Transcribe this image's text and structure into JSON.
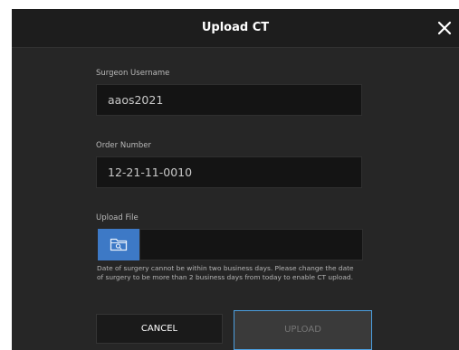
{
  "dialog": {
    "title": "Upload CT",
    "close_icon": "close-icon"
  },
  "fields": {
    "surgeon_username": {
      "label": "Surgeon Username",
      "value": "aaos2021"
    },
    "order_number": {
      "label": "Order Number",
      "value": "12-21-11-0010"
    },
    "upload_file": {
      "label": "Upload File",
      "value": "",
      "button_icon": "folder-search-icon"
    }
  },
  "warning": "Date of surgery cannot be within two business days. Please change the date of surgery to be more than 2 business days from today to enable CT upload.",
  "buttons": {
    "cancel": "CANCEL",
    "upload": "UPLOAD"
  },
  "colors": {
    "dialog_background": "#262626",
    "header_background": "#1d1d1d",
    "field_background": "#141414",
    "folder_button": "#3d79c6",
    "upload_focus_border": "#4c9fe0",
    "upload_disabled_text": "#767676"
  }
}
